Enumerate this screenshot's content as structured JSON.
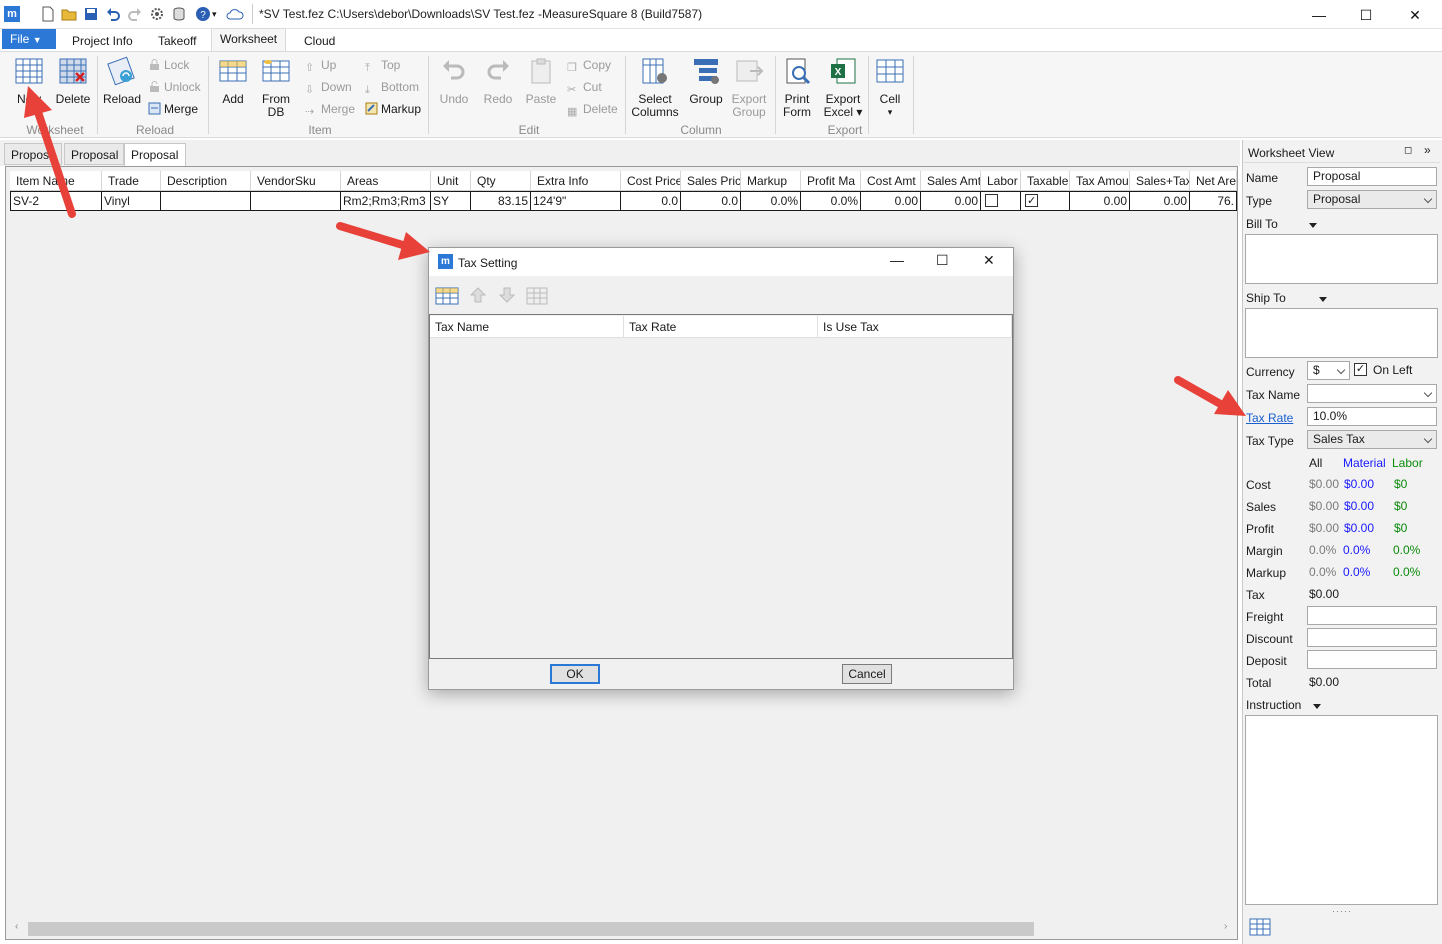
{
  "title_bar": {
    "text": "*SV Test.fez C:\\Users\\debor\\Downloads\\SV Test.fez -MeasureSquare 8 (Build7587)",
    "minimize": "—",
    "maximize": "☐",
    "close": "✕"
  },
  "ribbon_tabs": {
    "file": "File",
    "project_info": "Project Info",
    "takeoff": "Takeoff",
    "worksheet": "Worksheet",
    "cloud": "Cloud"
  },
  "ribbon": {
    "new": "New",
    "delete": "Delete",
    "group_worksheet": "Worksheet",
    "reload": "Reload",
    "lock": "Lock",
    "unlock": "Unlock",
    "merge": "Merge",
    "group_reload": "Reload",
    "add": "Add",
    "from_db_1": "From",
    "from_db_2": "DB",
    "up": "Up",
    "down": "Down",
    "merge_item": "Merge",
    "top": "Top",
    "bottom": "Bottom",
    "markup": "Markup",
    "group_item": "Item",
    "undo": "Undo",
    "redo": "Redo",
    "paste": "Paste",
    "copy": "Copy",
    "cut": "Cut",
    "delete_edit": "Delete",
    "group_edit": "Edit",
    "select_columns_1": "Select",
    "select_columns_2": "Columns",
    "group_btn": "Group",
    "export_group_1": "Export",
    "export_group_2": "Group",
    "group_column": "Column",
    "print_form_1": "Print",
    "print_form_2": "Form",
    "export_excel_1": "Export",
    "export_excel_2": "Excel ▾",
    "group_export": "Export",
    "cell": "Cell",
    "cell_caret": "▾"
  },
  "doc_tabs": [
    "Propos",
    "Proposal",
    "Proposal"
  ],
  "grid": {
    "headers": [
      "Item Name",
      "Trade",
      "Description",
      "VendorSku",
      "Areas",
      "Unit",
      "Qty",
      "Extra Info",
      "Cost Price",
      "Sales Pric",
      "Markup",
      "Profit Ma",
      "Cost Amt",
      "Sales Amt",
      "Labor",
      "Taxable",
      "Tax Amou",
      "Sales+Tax",
      "Net Are"
    ],
    "row": {
      "item_name": "SV-2",
      "trade": "Vinyl",
      "description": "",
      "vendor_sku": "",
      "areas": "Rm2;Rm3;Rm3",
      "unit": "SY",
      "qty": "83.15",
      "extra_info": "124'9\"",
      "cost_price": "0.0",
      "sales_price": "0.0",
      "markup": "0.0%",
      "profit_margin": "0.0%",
      "cost_amt": "0.00",
      "sales_amt": "0.00",
      "labor": false,
      "taxable": true,
      "tax_amount": "0.00",
      "sales_tax": "0.00",
      "net_area": "76."
    }
  },
  "side_panel": {
    "title": "Worksheet View",
    "name_label": "Name",
    "name_value": "Proposal",
    "type_label": "Type",
    "type_value": "Proposal",
    "bill_to": "Bill To",
    "ship_to": "Ship To",
    "currency_label": "Currency",
    "currency_value": "$",
    "on_left": "On Left",
    "tax_name_label": "Tax Name",
    "tax_name_value": "",
    "tax_rate_label": "Tax Rate",
    "tax_rate_value": "10.0%",
    "tax_type_label": "Tax Type",
    "tax_type_value": "Sales Tax",
    "col_all": "All",
    "col_material": "Material",
    "col_labor": "Labor",
    "cost_label": "Cost",
    "cost": [
      "$0.00",
      "$0.00",
      "$0"
    ],
    "sales_label": "Sales",
    "sales": [
      "$0.00",
      "$0.00",
      "$0"
    ],
    "profit_label": "Profit",
    "profit": [
      "$0.00",
      "$0.00",
      "$0"
    ],
    "margin_label": "Margin",
    "margin": [
      "0.0%",
      "0.0%",
      "0.0%"
    ],
    "markup_label": "Markup",
    "markup": [
      "0.0%",
      "0.0%",
      "0.0%"
    ],
    "tax_label": "Tax",
    "tax_value": "$0.00",
    "freight_label": "Freight",
    "discount_label": "Discount",
    "deposit_label": "Deposit",
    "total_label": "Total",
    "total_value": "$0.00",
    "instruction_label": "Instruction"
  },
  "dialog": {
    "title": "Tax Setting",
    "col_tax_name": "Tax Name",
    "col_tax_rate": "Tax Rate",
    "col_is_use_tax": "Is Use Tax",
    "ok": "OK",
    "cancel": "Cancel"
  },
  "colors": {
    "accent": "#2b78d6",
    "annotation_arrow": "#e8413a",
    "link": "#1a5fd0"
  }
}
